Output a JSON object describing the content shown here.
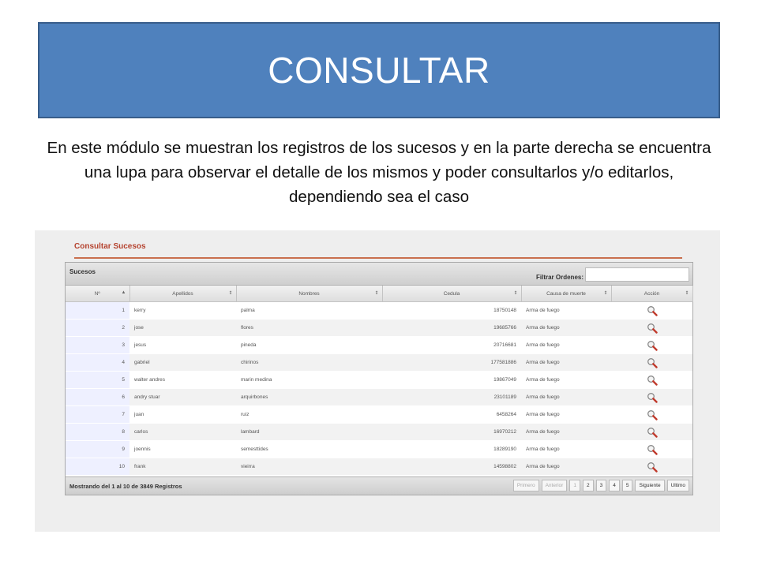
{
  "slide": {
    "title": "CONSULTAR",
    "description": "En este módulo se muestran los registros de los sucesos y en la parte derecha se encuentra una lupa para observar el detalle de los mismos y poder consultarlos y/o editarlos, dependiendo sea el caso"
  },
  "screenshot": {
    "panel_title": "Consultar Sucesos",
    "grid_caption": "Sucesos",
    "filter_label": "Filtrar Ordenes:",
    "filter_value": "",
    "columns": [
      "Nº",
      "Apellidos",
      "Nombres",
      "Cedula",
      "Causa de muerte",
      "Acción"
    ],
    "rows": [
      {
        "n": "1",
        "apellidos": "kerry",
        "nombres": "palma",
        "cedula": "18750148",
        "causa": "Arma de fuego"
      },
      {
        "n": "2",
        "apellidos": "jose",
        "nombres": "flores",
        "cedula": "19685766",
        "causa": "Arma de fuego"
      },
      {
        "n": "3",
        "apellidos": "jesus",
        "nombres": "pineda",
        "cedula": "20716681",
        "causa": "Arma de fuego"
      },
      {
        "n": "4",
        "apellidos": "gabriel",
        "nombres": "chirinos",
        "cedula": "177581886",
        "causa": "Arma de fuego"
      },
      {
        "n": "5",
        "apellidos": "walter andres",
        "nombres": "marin medina",
        "cedula": "19867049",
        "causa": "Arma de fuego"
      },
      {
        "n": "6",
        "apellidos": "andry stuar",
        "nombres": "arquirbones",
        "cedula": "23101189",
        "causa": "Arma de fuego"
      },
      {
        "n": "7",
        "apellidos": "juan",
        "nombres": "ruiz",
        "cedula": "6458264",
        "causa": "Arma de fuego"
      },
      {
        "n": "8",
        "apellidos": "carlos",
        "nombres": "lambard",
        "cedula": "16970212",
        "causa": "Arma de fuego"
      },
      {
        "n": "9",
        "apellidos": "joennis",
        "nombres": "semesttides",
        "cedula": "18289190",
        "causa": "Arma de fuego"
      },
      {
        "n": "10",
        "apellidos": "frank",
        "nombres": "vieirra",
        "cedula": "14598802",
        "causa": "Arma de fuego"
      }
    ],
    "footer_info": "Mostrando del 1 al 10 de 3849 Registros",
    "pager": {
      "first": "Primero",
      "previous": "Anterior",
      "pages": [
        "1",
        "2",
        "3",
        "4",
        "5"
      ],
      "next": "Siguiente",
      "last": "Ultimo"
    },
    "action_icon": "magnifier-icon",
    "colors": {
      "title_bg": "#4f81bd",
      "panel_title": "#b5432f",
      "lupa": "#c0392b"
    }
  }
}
